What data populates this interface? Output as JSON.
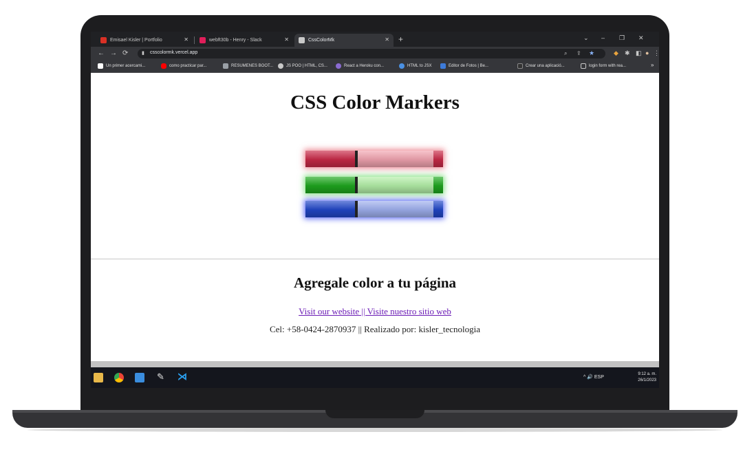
{
  "tabs": [
    {
      "title": "Emisael Kisler | Portfolio",
      "favicon_color": "#d93025"
    },
    {
      "title": "webft30b - Henry - Slack",
      "favicon_color": "#e01e5a"
    },
    {
      "title": "CssColorMk",
      "favicon_color": "#c9c9c9"
    }
  ],
  "toolbar": {
    "back": "←",
    "forward": "→",
    "reload": "⟳",
    "lock": "🔒",
    "url": "csscolormk.vercel.app",
    "icons": [
      "zoom-icon",
      "share-icon",
      "star-icon",
      "extension-icon",
      "puzzle-icon",
      "sidepanel-icon",
      "profile-icon",
      "menu-icon"
    ]
  },
  "window_controls": {
    "chevron": "⌄",
    "minimize": "–",
    "restore": "❐",
    "close": "✕"
  },
  "new_tab": "+",
  "bookmarks": [
    {
      "label": "Un primer acercami...",
      "color": "#ffffff"
    },
    {
      "label": "como practicar par...",
      "color": "#ff0000"
    },
    {
      "label": "RESUMENES BOOT...",
      "color": "#9aa0a6"
    },
    {
      "label": "JS POO | HTML, CS...",
      "color": "#c9c9c9"
    },
    {
      "label": "React a Heroku con...",
      "color": "#8a6bd1"
    },
    {
      "label": "HTML to JSX",
      "color": "#4a90e2"
    },
    {
      "label": "Editor de Fotos | Be...",
      "color": "#3d7bd9"
    },
    {
      "label": "Crear una aplicació...",
      "color": "#333333"
    },
    {
      "label": "login form with rea...",
      "color": "#c9c9c9"
    }
  ],
  "bookmarks_more": "»",
  "page": {
    "title": "CSS Color Markers",
    "subtitle": "Agregale color a tu página",
    "link": "Visit our website || Visite nuestro sitio web",
    "footer": "Cel: +58-0424-2870937 || Realizado por: kisler_tecnologia"
  },
  "markers": [
    {
      "name": "red",
      "cap": "#c92a48",
      "body": "#f2a4b0",
      "tip": "#c92a48",
      "glow": "rgba(220,40,60,0.55)"
    },
    {
      "name": "green",
      "cap": "#1fa81f",
      "body": "#b4f0a8",
      "tip": "#1fa81f",
      "glow": "rgba(40,200,40,0.55)"
    },
    {
      "name": "blue",
      "cap": "#2147c8",
      "body": "#9fb0ef",
      "tip": "#2147c8",
      "glow": "rgba(40,60,240,0.75)"
    }
  ],
  "taskbar": {
    "apps": [
      "file-explorer-icon",
      "chrome-icon",
      "photos-icon",
      "paint-icon",
      "vscode-icon"
    ],
    "tray": "^  🔊  ESP",
    "time": "9:12 a. m.",
    "date": "26/1/2023"
  }
}
